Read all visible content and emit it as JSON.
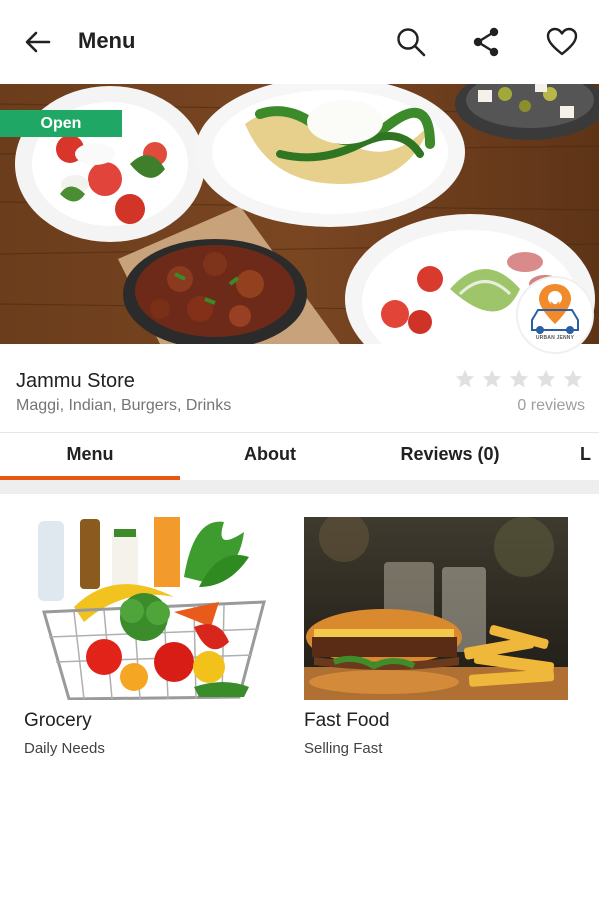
{
  "appbar": {
    "title": "Menu",
    "back_icon": "arrow-back-icon",
    "actions": [
      "search-icon",
      "share-icon",
      "heart-icon"
    ]
  },
  "hero": {
    "status_badge": "Open",
    "logo_text": "URBAN JENNY"
  },
  "store": {
    "name": "Jammu Store",
    "categories": "Maggi, Indian, Burgers, Drinks",
    "rating": 0,
    "reviews_text": "0 reviews"
  },
  "tabs": [
    {
      "label": "Menu"
    },
    {
      "label": "About"
    },
    {
      "label": "Reviews (0)"
    },
    {
      "label": "L"
    }
  ],
  "categories": [
    {
      "name": "Grocery",
      "subtitle": "Daily Needs"
    },
    {
      "name": "Fast Food",
      "subtitle": "Selling Fast"
    }
  ],
  "colors": {
    "accent": "#e8580f",
    "open_badge": "#1fa865",
    "star_empty": "#e0e0e0"
  }
}
